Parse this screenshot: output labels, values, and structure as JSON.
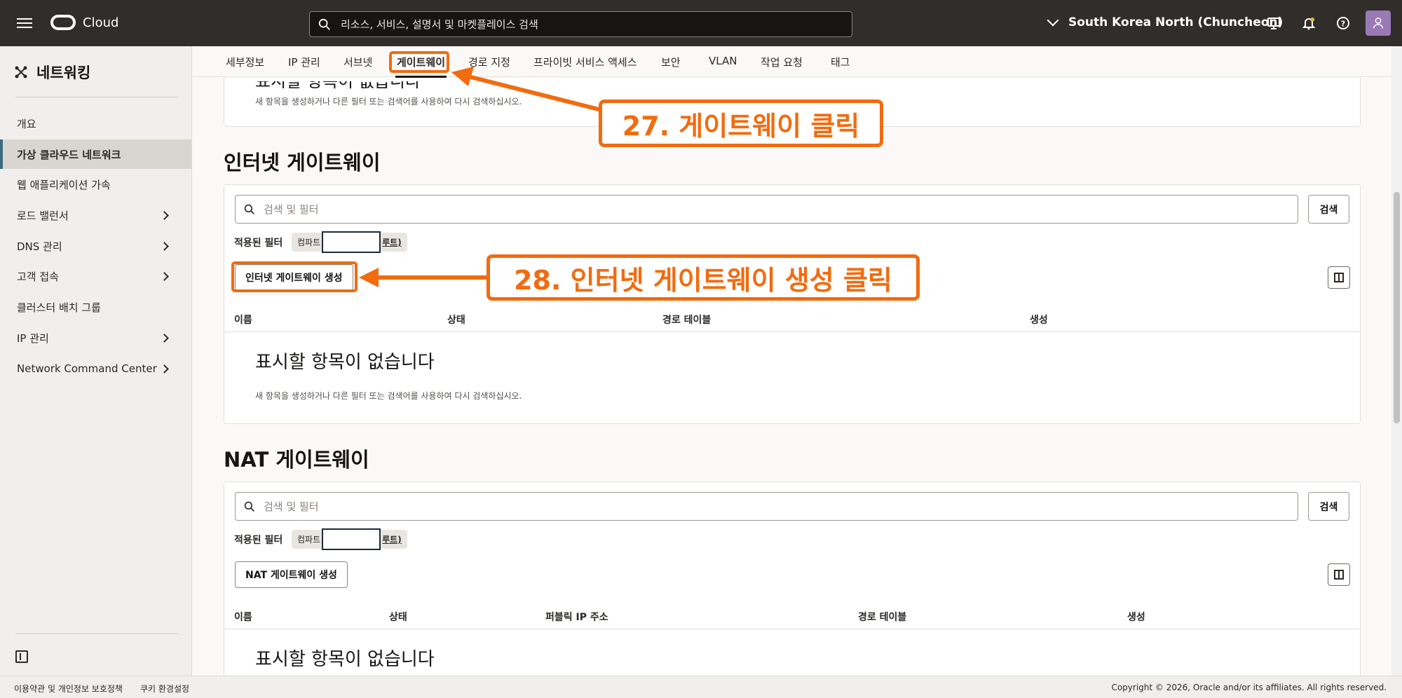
{
  "topbar": {
    "brand": "Cloud",
    "search_placeholder": "리소스, 서비스, 설명서 및 마켓플레이스 검색",
    "region": "South Korea North (Chuncheon)"
  },
  "sidebar": {
    "title": "네트워킹",
    "items": [
      {
        "label": "개요"
      },
      {
        "label": "가상 클라우드 네트워크"
      },
      {
        "label": "웹 애플리케이션 가속"
      },
      {
        "label": "로드 밸런서"
      },
      {
        "label": "DNS 관리"
      },
      {
        "label": "고객 접속"
      },
      {
        "label": "클러스터 배치 그룹"
      },
      {
        "label": "IP 관리"
      },
      {
        "label": "Network Command Center"
      }
    ]
  },
  "tabs": [
    "세부정보",
    "IP 관리",
    "서브넷",
    "게이트웨이",
    "경로 지정",
    "프라이빗 서비스 액세스",
    "보안",
    "VLAN",
    "작업 요청",
    "태그"
  ],
  "top_section": {
    "partial_title": "표시할 항목이 없습니다",
    "sub": "새 항목을 생성하거나 다른 필터 또는 검색어를 사용하여 다시 검색하십시오."
  },
  "internet_gateway": {
    "title": "인터넷 게이트웨이",
    "filter_placeholder": "검색 및 필터",
    "search_button": "검색",
    "applied_filter_label": "적용된 필터",
    "chip_prefix": "컴파트",
    "chip_suffix": "루트)",
    "create_button": "인터넷 게이트웨이 생성",
    "columns": [
      "이름",
      "상태",
      "경로 테이블",
      "생성"
    ],
    "empty_title": "표시할 항목이 없습니다",
    "empty_sub": "새 항목을 생성하거나 다른 필터 또는 검색어를 사용하여 다시 검색하십시오."
  },
  "nat_gateway": {
    "title": "NAT 게이트웨이",
    "filter_placeholder": "검색 및 필터",
    "search_button": "검색",
    "applied_filter_label": "적용된 필터",
    "chip_prefix": "컴파트",
    "chip_suffix": "루트)",
    "create_button": "NAT 게이트웨이 생성",
    "columns": [
      "이름",
      "상태",
      "퍼블릭 IP 주소",
      "경로 테이블",
      "생성"
    ],
    "empty_title": "표시할 항목이 없습니다"
  },
  "footer": {
    "terms": "이용약관 및 개인정보 보호정책",
    "cookies": "쿠키 환경설정",
    "copyright": "Copyright © 2026, Oracle and/or its affiliates. All rights reserved."
  },
  "annotations": {
    "step27": "27. 게이트웨이 클릭",
    "step28": "28. 인터넷 게이트웨이 생성 클릭"
  },
  "colors": {
    "accent": "#f26b0f",
    "topbar": "#312d2a"
  }
}
